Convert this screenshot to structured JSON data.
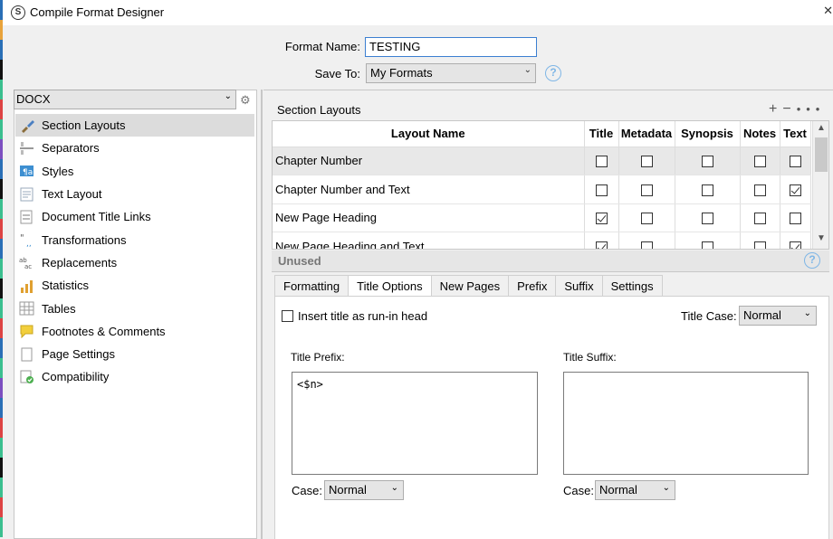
{
  "window": {
    "title": "Compile Format Designer",
    "close_glyph": "✕",
    "app_icon_glyph": "S"
  },
  "header": {
    "format_name_label": "Format Name:",
    "format_name_value": "TESTING",
    "save_to_label": "Save To:",
    "save_to_value": "My Formats",
    "help_glyph": "?"
  },
  "sidebar": {
    "format_select": "DOCX",
    "items": [
      {
        "label": "Section Layouts",
        "icon": "paintbrush-icon",
        "selected": true
      },
      {
        "label": "Separators",
        "icon": "separator-icon"
      },
      {
        "label": "Styles",
        "icon": "styles-icon"
      },
      {
        "label": "Text Layout",
        "icon": "text-layout-icon"
      },
      {
        "label": "Document Title Links",
        "icon": "title-links-icon"
      },
      {
        "label": "Transformations",
        "icon": "transformations-icon"
      },
      {
        "label": "Replacements",
        "icon": "replacements-icon"
      },
      {
        "label": "Statistics",
        "icon": "statistics-icon"
      },
      {
        "label": "Tables",
        "icon": "tables-icon"
      },
      {
        "label": "Footnotes & Comments",
        "icon": "footnotes-icon"
      },
      {
        "label": "Page Settings",
        "icon": "page-settings-icon"
      },
      {
        "label": "Compatibility",
        "icon": "compatibility-icon"
      }
    ]
  },
  "section_layouts": {
    "title": "Section Layouts",
    "columns": [
      "Layout Name",
      "Title",
      "Metadata",
      "Synopsis",
      "Notes",
      "Text"
    ],
    "rows": [
      {
        "name": "Chapter Number",
        "title": false,
        "metadata": false,
        "synopsis": false,
        "notes": false,
        "text": false
      },
      {
        "name": "Chapter Number and Text",
        "title": false,
        "metadata": false,
        "synopsis": false,
        "notes": false,
        "text": true
      },
      {
        "name": "New Page Heading",
        "title": true,
        "metadata": false,
        "synopsis": false,
        "notes": false,
        "text": false
      },
      {
        "name": "New Page Heading and Text",
        "title": true,
        "metadata": false,
        "synopsis": false,
        "notes": false,
        "text": true
      }
    ],
    "unused_label": "Unused"
  },
  "tabs": [
    "Formatting",
    "Title Options",
    "New Pages",
    "Prefix",
    "Suffix",
    "Settings"
  ],
  "active_tab": "Title Options",
  "title_options": {
    "run_in_label": "Insert title as run-in head",
    "run_in_checked": false,
    "title_case_label": "Title Case:",
    "title_case_value": "Normal",
    "prefix_label": "Title Prefix:",
    "prefix_value": "<$n>",
    "suffix_label": "Title Suffix:",
    "suffix_value": "",
    "case_label": "Case:",
    "prefix_case_value": "Normal",
    "suffix_case_value": "Normal"
  },
  "colors": {
    "accent": "#3c7fd1",
    "help": "#7fb6e6",
    "selection": "#dcdcdc"
  }
}
